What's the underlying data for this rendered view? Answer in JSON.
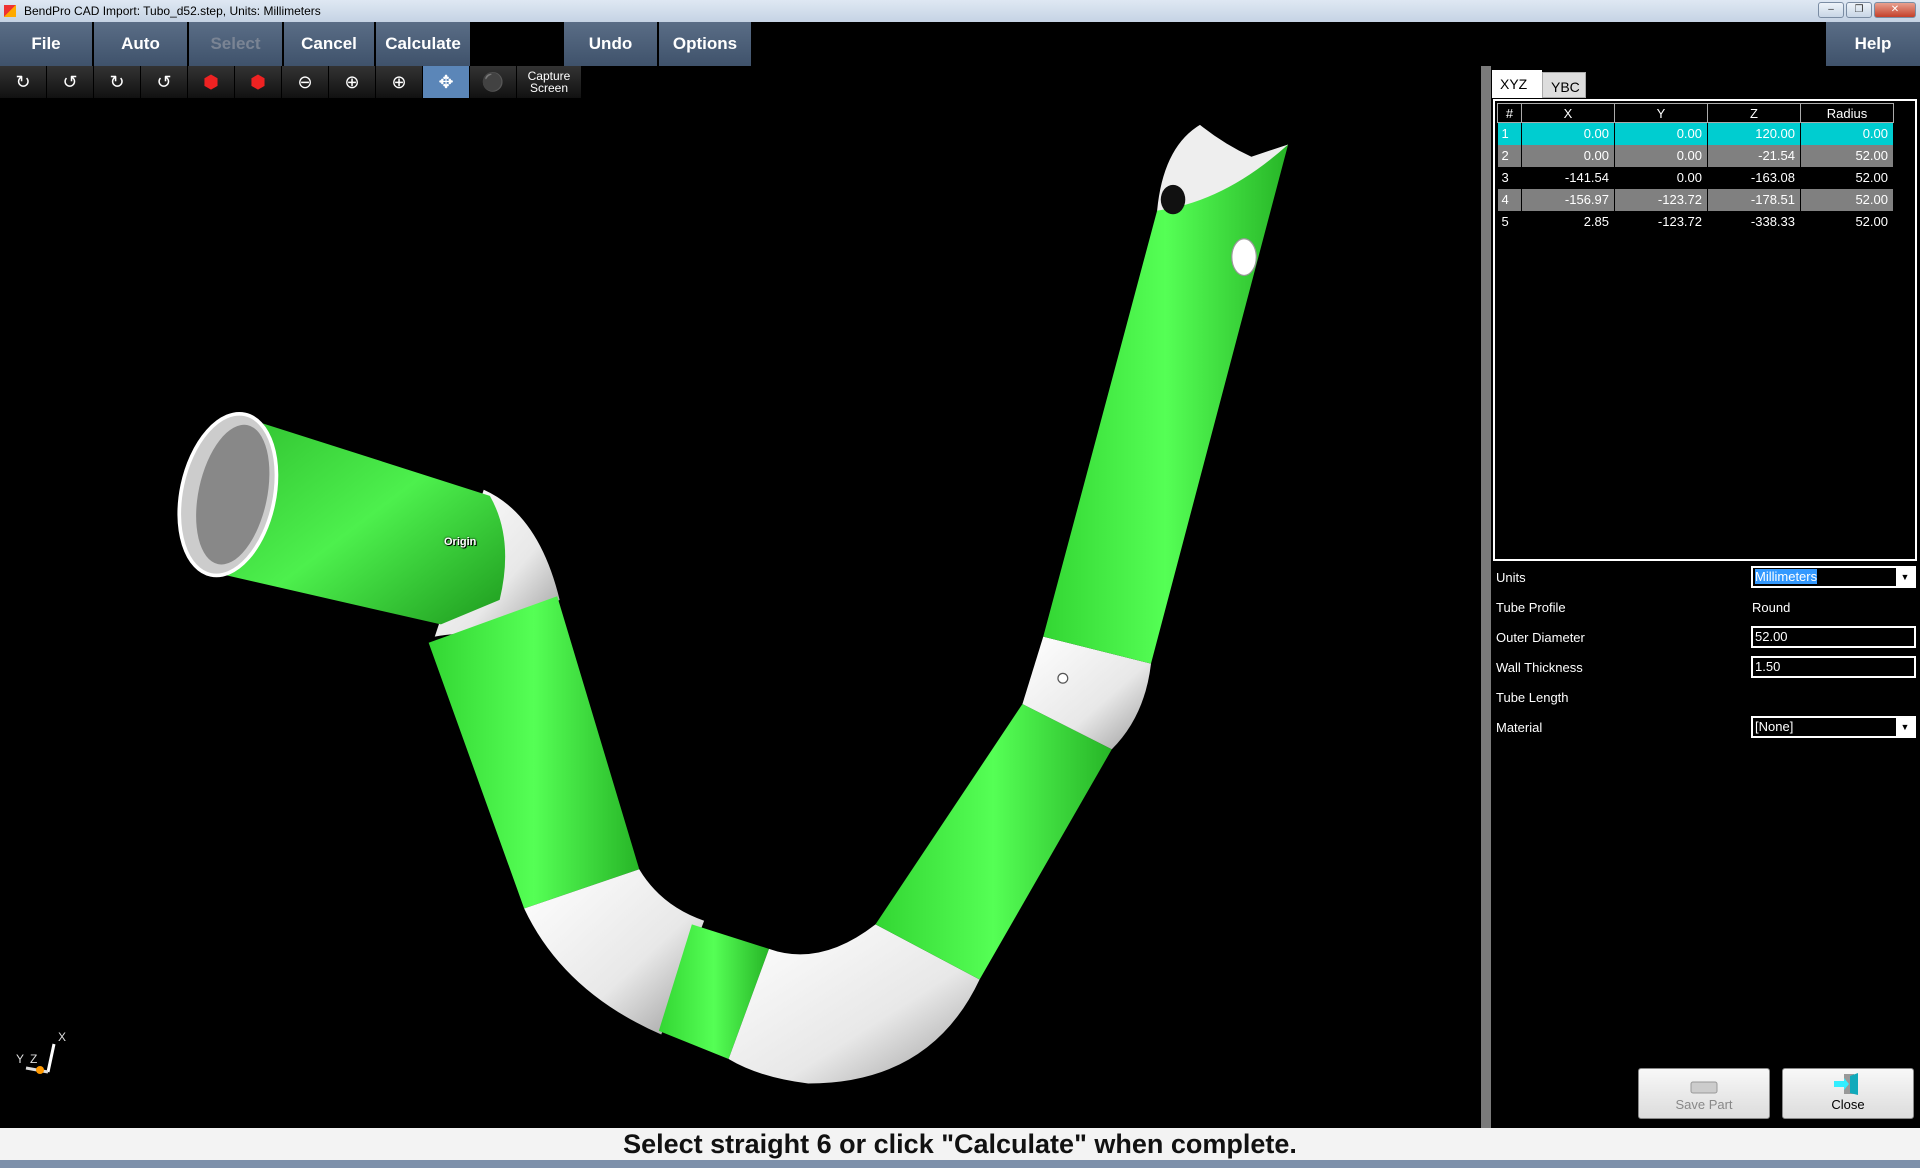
{
  "window": {
    "title": "BendPro CAD Import: Tubo_d52.step, Units: Millimeters",
    "controls": [
      "minimize",
      "restore",
      "close"
    ]
  },
  "menu": {
    "file": "File",
    "auto": "Auto",
    "select": "Select",
    "cancel": "Cancel",
    "calculate": "Calculate",
    "undo": "Undo",
    "options": "Options",
    "help": "Help"
  },
  "toolbar": {
    "icons": [
      "rotate-x-cw-icon",
      "rotate-x-ccw-icon",
      "rotate-y-cw-icon",
      "rotate-y-ccw-icon",
      "rotate-z-left-icon",
      "rotate-z-right-icon",
      "zoom-out-icon",
      "zoom-in-icon",
      "zoom-fit-icon",
      "pan-icon",
      "center-icon"
    ],
    "capture_line1": "Capture",
    "capture_line2": "Screen",
    "active": "pan-icon"
  },
  "viewport": {
    "origin_label": "Origin",
    "axis_labels": {
      "x": "X",
      "y": "Y",
      "z": "Z"
    },
    "colors": {
      "straight": "#33e633",
      "bend": "#f2f2f2"
    }
  },
  "tabs": [
    {
      "label": "XYZ",
      "active": true
    },
    {
      "label": "YBC",
      "active": false
    }
  ],
  "table": {
    "headers": [
      "#",
      "X",
      "Y",
      "Z",
      "Radius"
    ],
    "rows": [
      [
        "1",
        "0.00",
        "0.00",
        "120.00",
        "0.00"
      ],
      [
        "2",
        "0.00",
        "0.00",
        "-21.54",
        "52.00"
      ],
      [
        "3",
        "-141.54",
        "0.00",
        "-163.08",
        "52.00"
      ],
      [
        "4",
        "-156.97",
        "-123.72",
        "-178.51",
        "52.00"
      ],
      [
        "5",
        "2.85",
        "-123.72",
        "-338.33",
        "52.00"
      ]
    ],
    "selected_row": 1,
    "selection_color": "#00cdd0"
  },
  "properties": {
    "units_label": "Units",
    "units_value": "Millimeters",
    "profile_label": "Tube Profile",
    "profile_value": "Round",
    "od_label": "Outer Diameter",
    "od_value": "52.00",
    "wall_label": "Wall Thickness",
    "wall_value": "1.50",
    "length_label": "Tube Length",
    "material_label": "Material",
    "material_value": "[None]"
  },
  "buttons": {
    "save_part": "Save Part",
    "close": "Close"
  },
  "status": "Select straight 6 or click \"Calculate\" when complete."
}
